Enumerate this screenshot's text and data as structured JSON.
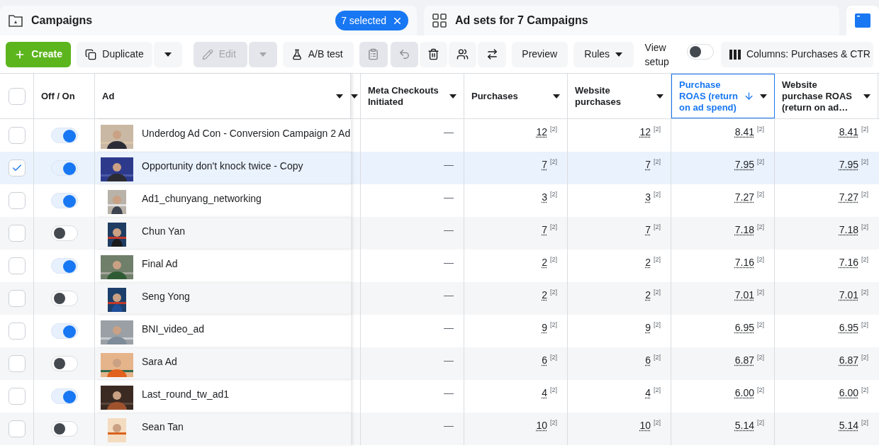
{
  "tabs": [
    {
      "kind": "campaigns",
      "label": "Campaigns",
      "badge": "7 selected"
    },
    {
      "kind": "adsets",
      "label": "Ad sets for 7 Campaigns"
    },
    {
      "kind": "ads"
    }
  ],
  "toolbar": {
    "create": "Create",
    "duplicate": "Duplicate",
    "edit": {
      "label": "Edit",
      "disabled": true
    },
    "ab_test": "A/B test",
    "icon_buttons": [
      {
        "disabled": true
      },
      {
        "disabled": true
      },
      {
        "disabled": false
      },
      {
        "disabled": false
      },
      {
        "disabled": false
      }
    ],
    "preview": "Preview",
    "rules": "Rules",
    "view_setup": {
      "label": "View setup",
      "on": false
    },
    "columns": "Columns: Purchases & CTR"
  },
  "table": {
    "select_all": {
      "checked": false
    },
    "columns": [
      {
        "label": "Off / On",
        "sorted": false
      },
      {
        "label": "Ad",
        "sorted": false
      },
      {
        "label": "Meta Checkouts Initiated",
        "sorted": false
      },
      {
        "label": "Purchases",
        "sorted": false
      },
      {
        "label": "Website purchases",
        "sorted": false
      },
      {
        "label": "Purchase ROAS (return on ad spend)",
        "sorted": true
      },
      {
        "label": "Website purchase ROAS (return on ad…",
        "sorted": false
      }
    ],
    "rows": [
      {
        "checked": false,
        "on": true,
        "ad": "Underdog Ad Con - Conversion Campaign 2 Ad",
        "meta_checkouts": "—",
        "metrics": [
          {
            "value": "12",
            "note": "[2]"
          },
          {
            "value": "12",
            "note": "[2]"
          },
          {
            "value": "8.41",
            "note": "[2]"
          },
          {
            "value": "8.41",
            "note": "[2]"
          }
        ]
      },
      {
        "checked": true,
        "on": true,
        "ad": "Opportunity don't knock twice - Copy",
        "meta_checkouts": "—",
        "metrics": [
          {
            "value": "7",
            "note": "[2]"
          },
          {
            "value": "7",
            "note": "[2]"
          },
          {
            "value": "7.95",
            "note": "[2]"
          },
          {
            "value": "7.95",
            "note": "[2]"
          }
        ]
      },
      {
        "checked": false,
        "on": true,
        "ad": "Ad1_chunyang_networking",
        "meta_checkouts": "—",
        "metrics": [
          {
            "value": "3",
            "note": "[2]"
          },
          {
            "value": "3",
            "note": "[2]"
          },
          {
            "value": "7.27",
            "note": "[2]"
          },
          {
            "value": "7.27",
            "note": "[2]"
          }
        ]
      },
      {
        "checked": false,
        "on": false,
        "ad": "Chun Yan",
        "meta_checkouts": "—",
        "metrics": [
          {
            "value": "7",
            "note": "[2]"
          },
          {
            "value": "7",
            "note": "[2]"
          },
          {
            "value": "7.18",
            "note": "[2]"
          },
          {
            "value": "7.18",
            "note": "[2]"
          }
        ]
      },
      {
        "checked": false,
        "on": true,
        "ad": "Final Ad",
        "meta_checkouts": "—",
        "metrics": [
          {
            "value": "2",
            "note": "[2]"
          },
          {
            "value": "2",
            "note": "[2]"
          },
          {
            "value": "7.16",
            "note": "[2]"
          },
          {
            "value": "7.16",
            "note": "[2]"
          }
        ]
      },
      {
        "checked": false,
        "on": false,
        "ad": "Seng Yong",
        "meta_checkouts": "—",
        "metrics": [
          {
            "value": "2",
            "note": "[2]"
          },
          {
            "value": "2",
            "note": "[2]"
          },
          {
            "value": "7.01",
            "note": "[2]"
          },
          {
            "value": "7.01",
            "note": "[2]"
          }
        ]
      },
      {
        "checked": false,
        "on": true,
        "ad": "BNI_video_ad",
        "meta_checkouts": "—",
        "metrics": [
          {
            "value": "9",
            "note": "[2]"
          },
          {
            "value": "9",
            "note": "[2]"
          },
          {
            "value": "6.95",
            "note": "[2]"
          },
          {
            "value": "6.95",
            "note": "[2]"
          }
        ]
      },
      {
        "checked": false,
        "on": false,
        "ad": "Sara Ad",
        "meta_checkouts": "—",
        "metrics": [
          {
            "value": "6",
            "note": "[2]"
          },
          {
            "value": "6",
            "note": "[2]"
          },
          {
            "value": "6.87",
            "note": "[2]"
          },
          {
            "value": "6.87",
            "note": "[2]"
          }
        ]
      },
      {
        "checked": false,
        "on": true,
        "ad": "Last_round_tw_ad1",
        "meta_checkouts": "—",
        "metrics": [
          {
            "value": "4",
            "note": "[2]"
          },
          {
            "value": "4",
            "note": "[2]"
          },
          {
            "value": "6.00",
            "note": "[2]"
          },
          {
            "value": "6.00",
            "note": "[2]"
          }
        ]
      },
      {
        "checked": false,
        "on": false,
        "ad": "Sean Tan",
        "meta_checkouts": "—",
        "metrics": [
          {
            "value": "10",
            "note": "[2]"
          },
          {
            "value": "10",
            "note": "[2]"
          },
          {
            "value": "5.14",
            "note": "[2]"
          },
          {
            "value": "5.14",
            "note": "[2]"
          }
        ]
      }
    ]
  }
}
